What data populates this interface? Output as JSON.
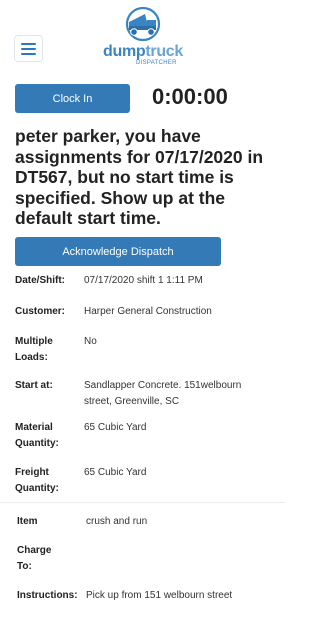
{
  "header": {
    "logo_word_1": "dump",
    "logo_word_2": "truck",
    "logo_sub": "DISPATCHER"
  },
  "clock": {
    "button_label": "Clock In",
    "timer": "0:00:00"
  },
  "assignment_message": "peter parker, you have assignments for 07/17/2020 in DT567, but no start time is specified. Show up at the default start time.",
  "acknowledge_label": "Acknowledge Dispatch",
  "fields": {
    "date_shift": {
      "label": "Date/Shift:",
      "value": "07/17/2020 shift 1 1:11 PM"
    },
    "customer": {
      "label": "Customer:",
      "value": "Harper General Construction"
    },
    "multiple_loads": {
      "label": "Multiple Loads:",
      "value": "No"
    },
    "start_at": {
      "label": "Start at:",
      "value": "Sandlapper Concrete. 151welbourn street, Greenville, SC"
    },
    "material_quantity": {
      "label": "Material Quantity:",
      "value": "65 Cubic Yard"
    },
    "freight_quantity": {
      "label": "Freight Quantity:",
      "value": "65 Cubic Yard"
    },
    "item": {
      "label": "Item",
      "value": "crush and run"
    },
    "charge_to": {
      "label": "Charge To:",
      "value": ""
    },
    "instructions": {
      "label": "Instructions:",
      "value": "Pick up from 151 welbourn street"
    }
  },
  "colors": {
    "primary_button": "#337ab7",
    "logo_blue": "#3b84c4"
  }
}
